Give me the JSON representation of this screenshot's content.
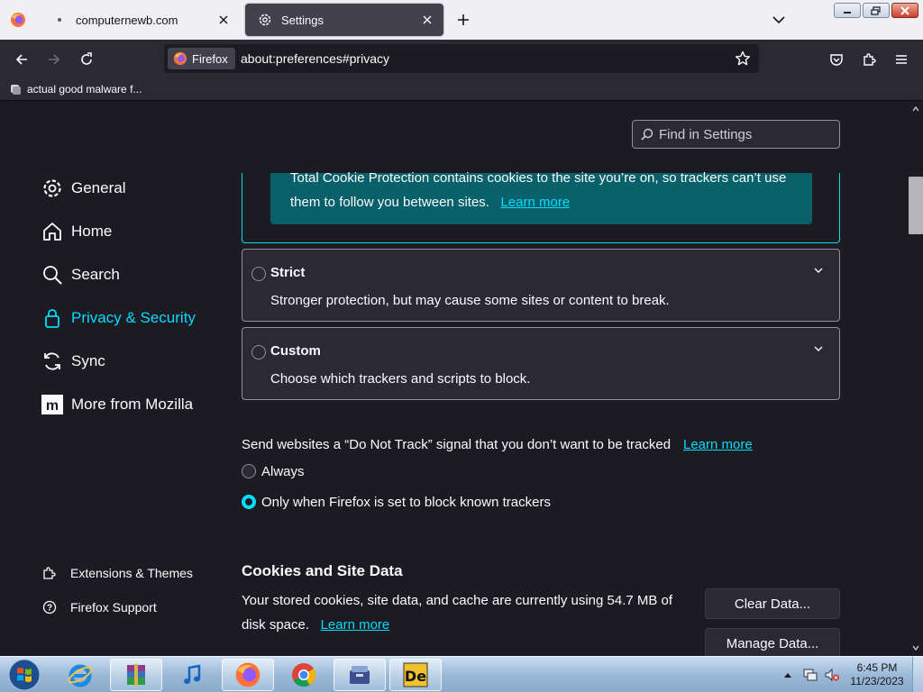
{
  "browser": {
    "tabs": [
      {
        "title": "computernewb.com",
        "icon": "dot-icon",
        "active": false
      },
      {
        "title": "Settings",
        "icon": "gear-icon",
        "active": true
      }
    ],
    "identity_label": "Firefox",
    "url": "about:preferences#privacy",
    "bookmarks": [
      {
        "label": "actual good malware f..."
      }
    ]
  },
  "settings": {
    "find_placeholder": "Find in Settings",
    "nav": [
      {
        "label": "General",
        "icon": "gear-icon"
      },
      {
        "label": "Home",
        "icon": "home-icon"
      },
      {
        "label": "Search",
        "icon": "search-icon"
      },
      {
        "label": "Privacy & Security",
        "icon": "lock-icon",
        "selected": true
      },
      {
        "label": "Sync",
        "icon": "sync-icon"
      },
      {
        "label": "More from Mozilla",
        "icon": "mozilla-icon"
      }
    ],
    "footer_nav": [
      {
        "label": "Extensions & Themes",
        "icon": "puzzle-icon"
      },
      {
        "label": "Firefox Support",
        "icon": "help-icon"
      }
    ],
    "etp": {
      "standard_text_1": "Total Cookie Protection contains cookies to the site you’re on, so trackers can’t use",
      "standard_text_2": "them to follow you between sites.",
      "learn_more": "Learn more",
      "strict": {
        "title": "Strict",
        "desc": "Stronger protection, but may cause some sites or content to break."
      },
      "custom": {
        "title": "Custom",
        "desc": "Choose which trackers and scripts to block."
      }
    },
    "dnt": {
      "label": "Send websites a “Do Not Track” signal that you don’t want to be tracked",
      "learn_more": "Learn more",
      "options": [
        {
          "label": "Always",
          "checked": false
        },
        {
          "label": "Only when Firefox is set to block known trackers",
          "checked": true
        }
      ]
    },
    "cookies": {
      "title": "Cookies and Site Data",
      "desc": "Your stored cookies, site data, and cache are currently using 54.7 MB of disk space.",
      "learn_more": "Learn more",
      "clear_button": "Clear Data...",
      "manage_button": "Manage Data..."
    }
  },
  "taskbar": {
    "apps": [
      "internet-explorer-icon",
      "winrar-icon",
      "itunes-icon",
      "firefox-icon",
      "chrome-icon",
      "archive-icon",
      "de-app-icon"
    ],
    "time": "6:45 PM",
    "date": "11/23/2023"
  },
  "colors": {
    "accent": "#00ddff",
    "background": "#1c1b22",
    "panel": "#2b2a33"
  }
}
